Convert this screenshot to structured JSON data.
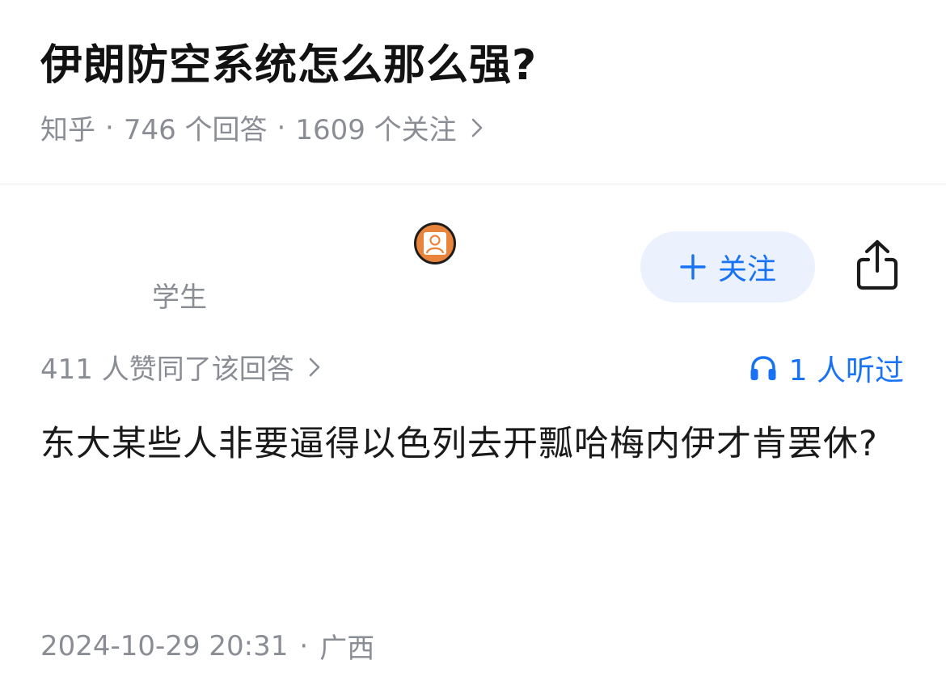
{
  "question": {
    "title": "伊朗防空系统怎么那么强?",
    "source": "知乎",
    "answers_count": "746 个回答",
    "followers_count": "1609 个关注",
    "separator": "·"
  },
  "author": {
    "headline": "学生"
  },
  "actions": {
    "follow_label": "关注",
    "follow_plus": "+"
  },
  "answer": {
    "votes_text": "411 人赞同了该回答",
    "listen_text": "1 人听过",
    "content": "东大某些人非要逼得以色列去开瓢哈梅内伊才肯罢休?",
    "date": "2024-10-29 20:31",
    "location": "广西",
    "separator": "·"
  },
  "colors": {
    "accent": "#1772f6",
    "follow_bg": "#ebf2fd",
    "muted": "#8a8d94",
    "avatar": "#e8843c"
  }
}
